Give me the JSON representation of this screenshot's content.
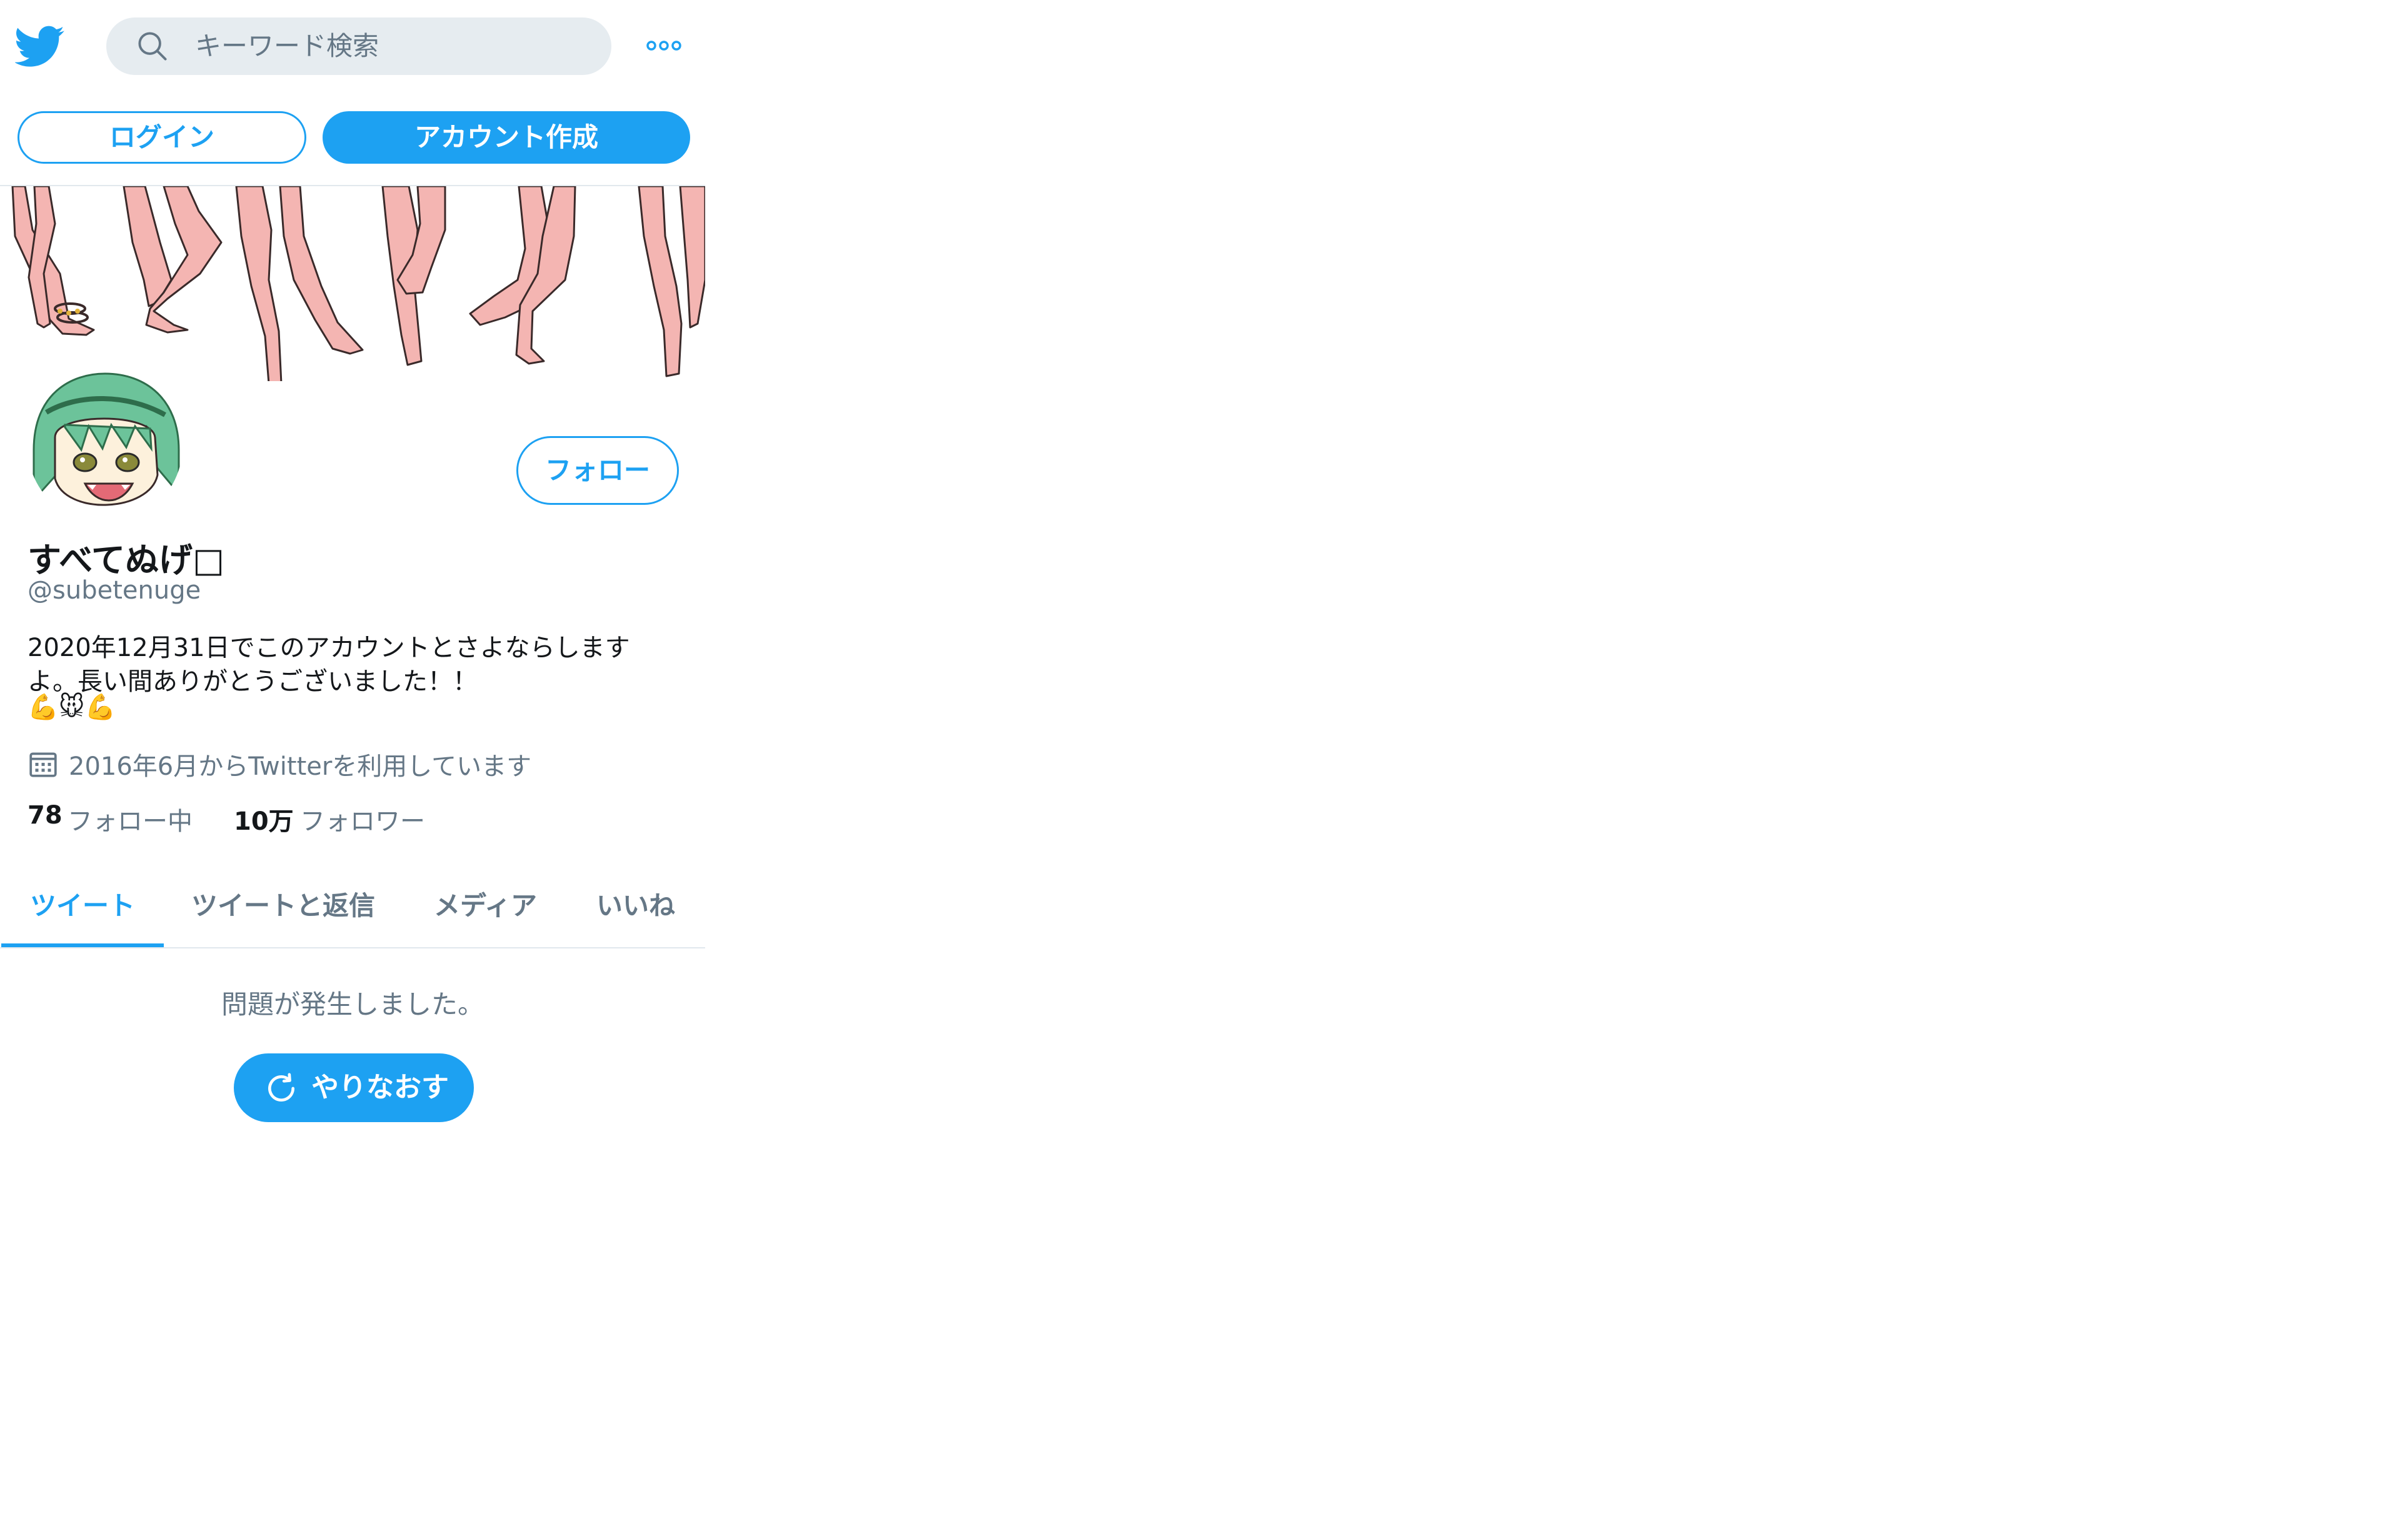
{
  "header": {
    "logo_icon": "twitter-bird-icon",
    "search_placeholder": "キーワード検索",
    "more_icon": "more-dots-icon",
    "login_label": "ログイン",
    "signup_label": "アカウント作成"
  },
  "profile": {
    "follow_label": "フォロー",
    "display_name": "すべてぬげ□",
    "handle": "@subetenuge",
    "bio_line1": "2020年12月31日でこのアカウントとさよならします",
    "bio_line2": "よ。長い間ありがとうございました！！",
    "bio_emoji": "💪🐭💪",
    "joined": "2016年6月からTwitterを利用しています",
    "following_count": "78",
    "following_label": "フォロー中",
    "followers_count": "10万",
    "followers_label": "フォロワー"
  },
  "tabs": [
    {
      "label": "ツイート",
      "active": true
    },
    {
      "label": "ツイートと返信",
      "active": false
    },
    {
      "label": "メディア",
      "active": false
    },
    {
      "label": "いいね",
      "active": false
    }
  ],
  "error": {
    "message": "問題が発生しました。",
    "retry_label": "やりなおす"
  },
  "colors": {
    "accent": "#1da1f2",
    "muted_text": "#657786",
    "primary_text": "#14171a",
    "search_bg": "#e6ecf0"
  }
}
